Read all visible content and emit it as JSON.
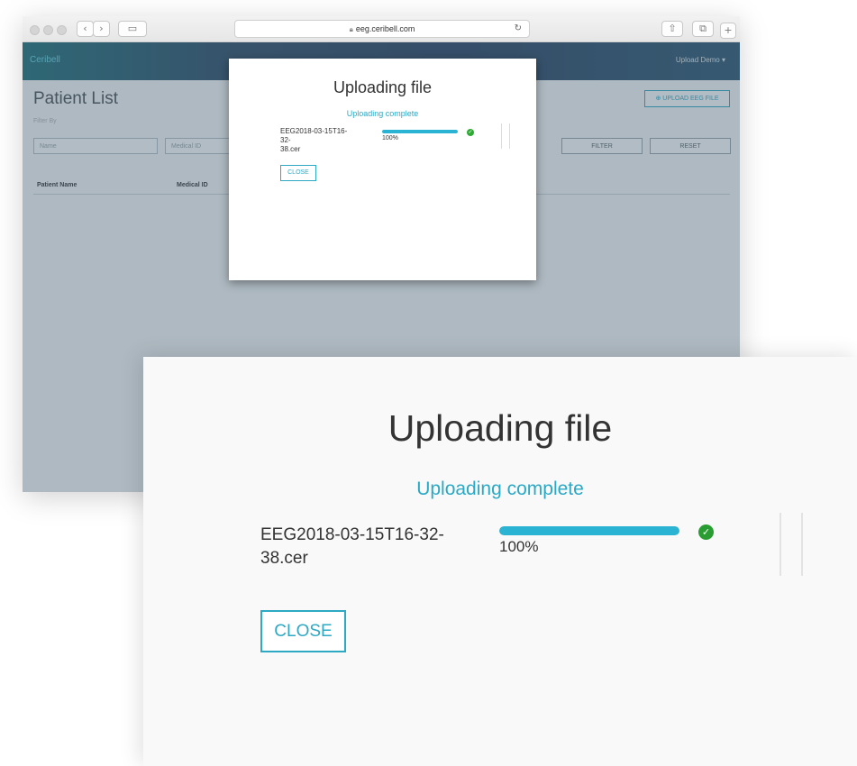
{
  "browser": {
    "url": "eeg.ceribell.com",
    "lock_icon": "lock-icon",
    "reload_icon": "reload-icon"
  },
  "app": {
    "brand": "Ceribell",
    "user_menu": "Upload Demo ▾",
    "page_title": "Patient List",
    "filter_by": "Filter By",
    "name_placeholder": "Name",
    "medical_id_placeholder": "Medical ID",
    "filter_label": "FILTER",
    "reset_label": "RESET",
    "upload_label": "⊕ UPLOAD EEG FILE",
    "columns": [
      "Patient Name",
      "Medical ID"
    ]
  },
  "modal": {
    "title": "Uploading file",
    "status": "Uploading complete",
    "file_name_line1": "EEG2018-03-15T16-32-",
    "file_name_line2": "38.cer",
    "progress_percent": 100,
    "progress_label": "100%",
    "close_label": "CLOSE",
    "accent_color": "#2aa9c6",
    "success_color": "#2dab34"
  }
}
